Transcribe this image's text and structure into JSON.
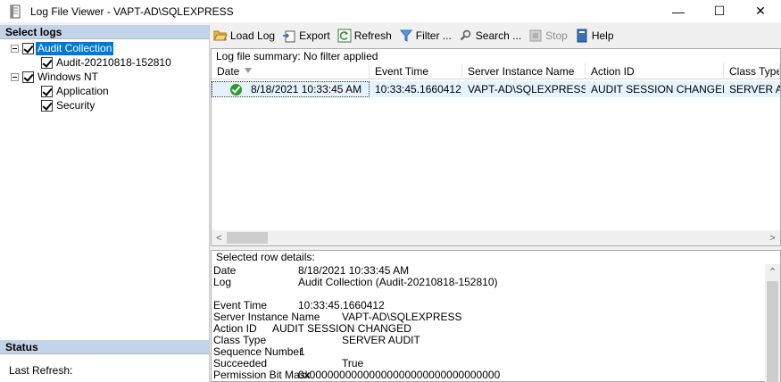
{
  "window": {
    "title": "Log File Viewer - VAPT-AD\\SQLEXPRESS",
    "minimize": "—",
    "maximize": "☐",
    "close": "✕"
  },
  "left_panel": {
    "header": "Select logs",
    "tree": [
      {
        "label": "Audit Collection",
        "checked": true,
        "selected": true
      },
      {
        "label": "Audit-20210818-152810",
        "checked": true
      },
      {
        "label": "Windows NT",
        "checked": true
      },
      {
        "label": "Application",
        "checked": true
      },
      {
        "label": "Security",
        "checked": true
      }
    ],
    "status_header": "Status",
    "last_refresh_label": "Last Refresh:"
  },
  "toolbar": {
    "load_log": "Load Log",
    "export": "Export",
    "refresh": "Refresh",
    "filter": "Filter ...",
    "search": "Search ...",
    "stop": "Stop",
    "help": "Help"
  },
  "grid": {
    "summary": "Log file summary: No filter applied",
    "columns": [
      "Date",
      "Event Time",
      "Server Instance Name",
      "Action ID",
      "Class Type"
    ],
    "rows": [
      {
        "date": "8/18/2021 10:33:45 AM",
        "event_time": "10:33:45.1660412",
        "server": "VAPT-AD\\SQLEXPRESS",
        "action": "AUDIT SESSION CHANGED",
        "class_type": "SERVER AUDIT"
      }
    ]
  },
  "details": {
    "title": "Selected row details:",
    "date_label": "Date",
    "date_value": "8/18/2021 10:33:45 AM",
    "log_label": "Log",
    "log_value": "Audit Collection (Audit-20210818-152810)",
    "event_time_label": "Event Time",
    "event_time_value": "10:33:45.1660412",
    "server_label": "Server Instance Name",
    "server_value": "VAPT-AD\\SQLEXPRESS",
    "action_label": "Action ID",
    "action_value": "AUDIT SESSION CHANGED",
    "class_label": "Class Type",
    "class_value": "SERVER AUDIT",
    "seq_label": "Sequence Number",
    "seq_value": "1",
    "succeeded_label": "Succeeded",
    "succeeded_value": "True",
    "perm_label": "Permission Bit Mask",
    "perm_value": "0x00000000000000000000000000000000"
  },
  "colors": {
    "selection": "#0078d7",
    "header_bg": "#c3d3e8",
    "row_highlight": "#e5f3ff",
    "success_green": "#2e9a2e"
  }
}
